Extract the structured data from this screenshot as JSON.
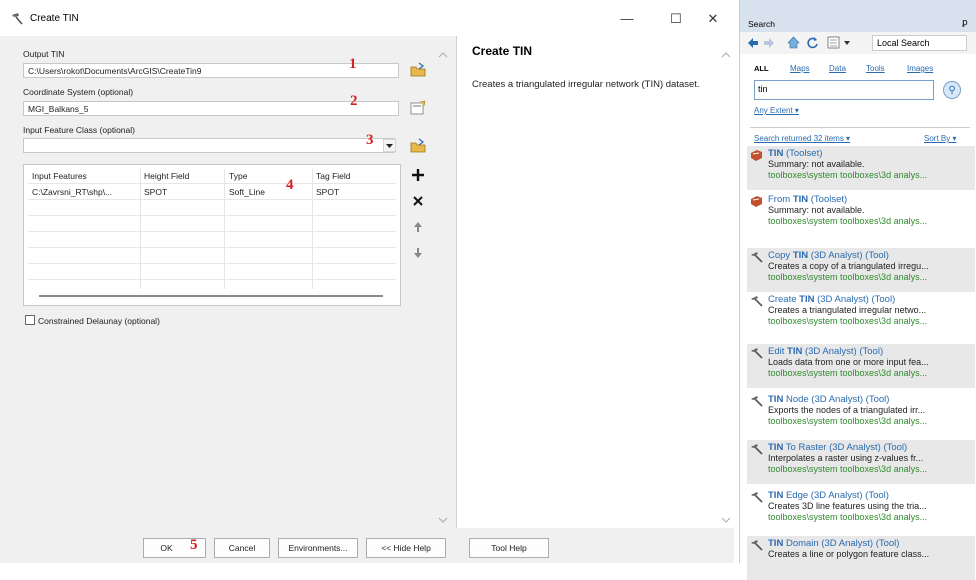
{
  "window": {
    "title": "Create TIN",
    "minimize": "—",
    "maximize": "☐",
    "close": "✕"
  },
  "form": {
    "output_label": "Output TIN",
    "output_value": "C:\\Users\\rokot\\Documents\\ArcGIS\\CreateTin9",
    "coord_label": "Coordinate System (optional)",
    "coord_value": "MGI_Balkans_5",
    "input_label": "Input Feature Class (optional)",
    "input_value": "",
    "grid_headers": [
      "Input Features",
      "Height Field",
      "Type",
      "Tag Field"
    ],
    "grid_row": [
      "C:\\Zavrsni_RT\\shp\\...",
      "SPOT",
      "Soft_Line",
      "SPOT"
    ],
    "constrained_label": "Constrained Delaunay (optional)",
    "constrained_checked": false
  },
  "markers": [
    "1",
    "2",
    "3",
    "4",
    "5"
  ],
  "help": {
    "title": "Create TIN",
    "text": "Creates a triangulated irregular network (TIN) dataset."
  },
  "buttons": {
    "ok": "OK",
    "cancel": "Cancel",
    "env": "Environments...",
    "hide_help": "<< Hide Help",
    "tool_help": "Tool Help"
  },
  "search": {
    "title": "Search",
    "pin": "ꝑ",
    "location": "Local Search",
    "tabs": [
      "ALL",
      "Maps",
      "Data",
      "Tools",
      "Images"
    ],
    "query": "tin",
    "extent": "Any Extent ▾",
    "returned": "Search returned 32 items ▾",
    "sort": "Sort By ▾",
    "results": [
      {
        "pre": "",
        "bold": "TIN",
        "post": " (Toolset)",
        "desc": "Summary: not available.",
        "path": "toolboxes\\system toolboxes\\3d analys...",
        "icon": "toolset-icon"
      },
      {
        "pre": "From ",
        "bold": "TIN",
        "post": " (Toolset)",
        "desc": "Summary: not available.",
        "path": "toolboxes\\system toolboxes\\3d analys...",
        "icon": "toolset-icon"
      },
      {
        "pre": "Copy ",
        "bold": "TIN",
        "post": " (3D Analyst) (Tool)",
        "desc": "Creates a copy of a triangulated irregu...",
        "path": "toolboxes\\system toolboxes\\3d analys...",
        "icon": "hammer-icon"
      },
      {
        "pre": "Create ",
        "bold": "TIN",
        "post": " (3D Analyst) (Tool)",
        "desc": "Creates a triangulated irregular netwo...",
        "path": "toolboxes\\system toolboxes\\3d analys...",
        "icon": "hammer-icon"
      },
      {
        "pre": "Edit ",
        "bold": "TIN",
        "post": " (3D Analyst) (Tool)",
        "desc": "Loads data from one or more input fea...",
        "path": "toolboxes\\system toolboxes\\3d analys...",
        "icon": "hammer-icon"
      },
      {
        "pre": "",
        "bold": "TIN",
        "post": " Node (3D Analyst) (Tool)",
        "desc": "Exports the nodes of a triangulated irr...",
        "path": "toolboxes\\system toolboxes\\3d analys...",
        "icon": "hammer-icon"
      },
      {
        "pre": "",
        "bold": "TIN",
        "post": " To Raster (3D Analyst) (Tool)",
        "desc": "Interpolates a raster using z-values fr...",
        "path": "toolboxes\\system toolboxes\\3d analys...",
        "icon": "hammer-icon"
      },
      {
        "pre": "",
        "bold": "TIN",
        "post": " Edge (3D Analyst) (Tool)",
        "desc": "Creates 3D line features using the tria...",
        "path": "toolboxes\\system toolboxes\\3d analys...",
        "icon": "hammer-icon"
      },
      {
        "pre": "",
        "bold": "TIN",
        "post": " Domain (3D Analyst) (Tool)",
        "desc": "Creates a line or polygon feature class...",
        "path": "",
        "icon": "hammer-icon"
      }
    ]
  },
  "colors": {
    "marker": "#d42020",
    "link": "#2a6bb0",
    "path": "#2e8b2e"
  }
}
